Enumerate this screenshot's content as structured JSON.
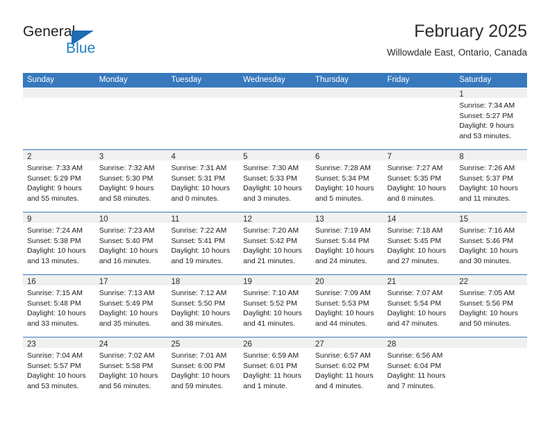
{
  "brand": {
    "name_part1": "General",
    "name_part2": "Blue",
    "triangle_icon": "triangle-icon",
    "accent_color": "#1f7ec4"
  },
  "header": {
    "title": "February 2025",
    "subtitle": "Willowdale East, Ontario, Canada"
  },
  "calendar": {
    "header_bg": "#3879bd",
    "day_strip_bg": "#f0f0f0",
    "weekdays": [
      "Sunday",
      "Monday",
      "Tuesday",
      "Wednesday",
      "Thursday",
      "Friday",
      "Saturday"
    ],
    "weeks": [
      [
        {
          "date": "",
          "lines": []
        },
        {
          "date": "",
          "lines": []
        },
        {
          "date": "",
          "lines": []
        },
        {
          "date": "",
          "lines": []
        },
        {
          "date": "",
          "lines": []
        },
        {
          "date": "",
          "lines": []
        },
        {
          "date": "1",
          "lines": [
            "Sunrise: 7:34 AM",
            "Sunset: 5:27 PM",
            "Daylight: 9 hours",
            "and 53 minutes."
          ]
        }
      ],
      [
        {
          "date": "2",
          "lines": [
            "Sunrise: 7:33 AM",
            "Sunset: 5:29 PM",
            "Daylight: 9 hours",
            "and 55 minutes."
          ]
        },
        {
          "date": "3",
          "lines": [
            "Sunrise: 7:32 AM",
            "Sunset: 5:30 PM",
            "Daylight: 9 hours",
            "and 58 minutes."
          ]
        },
        {
          "date": "4",
          "lines": [
            "Sunrise: 7:31 AM",
            "Sunset: 5:31 PM",
            "Daylight: 10 hours",
            "and 0 minutes."
          ]
        },
        {
          "date": "5",
          "lines": [
            "Sunrise: 7:30 AM",
            "Sunset: 5:33 PM",
            "Daylight: 10 hours",
            "and 3 minutes."
          ]
        },
        {
          "date": "6",
          "lines": [
            "Sunrise: 7:28 AM",
            "Sunset: 5:34 PM",
            "Daylight: 10 hours",
            "and 5 minutes."
          ]
        },
        {
          "date": "7",
          "lines": [
            "Sunrise: 7:27 AM",
            "Sunset: 5:35 PM",
            "Daylight: 10 hours",
            "and 8 minutes."
          ]
        },
        {
          "date": "8",
          "lines": [
            "Sunrise: 7:26 AM",
            "Sunset: 5:37 PM",
            "Daylight: 10 hours",
            "and 11 minutes."
          ]
        }
      ],
      [
        {
          "date": "9",
          "lines": [
            "Sunrise: 7:24 AM",
            "Sunset: 5:38 PM",
            "Daylight: 10 hours",
            "and 13 minutes."
          ]
        },
        {
          "date": "10",
          "lines": [
            "Sunrise: 7:23 AM",
            "Sunset: 5:40 PM",
            "Daylight: 10 hours",
            "and 16 minutes."
          ]
        },
        {
          "date": "11",
          "lines": [
            "Sunrise: 7:22 AM",
            "Sunset: 5:41 PM",
            "Daylight: 10 hours",
            "and 19 minutes."
          ]
        },
        {
          "date": "12",
          "lines": [
            "Sunrise: 7:20 AM",
            "Sunset: 5:42 PM",
            "Daylight: 10 hours",
            "and 21 minutes."
          ]
        },
        {
          "date": "13",
          "lines": [
            "Sunrise: 7:19 AM",
            "Sunset: 5:44 PM",
            "Daylight: 10 hours",
            "and 24 minutes."
          ]
        },
        {
          "date": "14",
          "lines": [
            "Sunrise: 7:18 AM",
            "Sunset: 5:45 PM",
            "Daylight: 10 hours",
            "and 27 minutes."
          ]
        },
        {
          "date": "15",
          "lines": [
            "Sunrise: 7:16 AM",
            "Sunset: 5:46 PM",
            "Daylight: 10 hours",
            "and 30 minutes."
          ]
        }
      ],
      [
        {
          "date": "16",
          "lines": [
            "Sunrise: 7:15 AM",
            "Sunset: 5:48 PM",
            "Daylight: 10 hours",
            "and 33 minutes."
          ]
        },
        {
          "date": "17",
          "lines": [
            "Sunrise: 7:13 AM",
            "Sunset: 5:49 PM",
            "Daylight: 10 hours",
            "and 35 minutes."
          ]
        },
        {
          "date": "18",
          "lines": [
            "Sunrise: 7:12 AM",
            "Sunset: 5:50 PM",
            "Daylight: 10 hours",
            "and 38 minutes."
          ]
        },
        {
          "date": "19",
          "lines": [
            "Sunrise: 7:10 AM",
            "Sunset: 5:52 PM",
            "Daylight: 10 hours",
            "and 41 minutes."
          ]
        },
        {
          "date": "20",
          "lines": [
            "Sunrise: 7:09 AM",
            "Sunset: 5:53 PM",
            "Daylight: 10 hours",
            "and 44 minutes."
          ]
        },
        {
          "date": "21",
          "lines": [
            "Sunrise: 7:07 AM",
            "Sunset: 5:54 PM",
            "Daylight: 10 hours",
            "and 47 minutes."
          ]
        },
        {
          "date": "22",
          "lines": [
            "Sunrise: 7:05 AM",
            "Sunset: 5:56 PM",
            "Daylight: 10 hours",
            "and 50 minutes."
          ]
        }
      ],
      [
        {
          "date": "23",
          "lines": [
            "Sunrise: 7:04 AM",
            "Sunset: 5:57 PM",
            "Daylight: 10 hours",
            "and 53 minutes."
          ]
        },
        {
          "date": "24",
          "lines": [
            "Sunrise: 7:02 AM",
            "Sunset: 5:58 PM",
            "Daylight: 10 hours",
            "and 56 minutes."
          ]
        },
        {
          "date": "25",
          "lines": [
            "Sunrise: 7:01 AM",
            "Sunset: 6:00 PM",
            "Daylight: 10 hours",
            "and 59 minutes."
          ]
        },
        {
          "date": "26",
          "lines": [
            "Sunrise: 6:59 AM",
            "Sunset: 6:01 PM",
            "Daylight: 11 hours",
            "and 1 minute."
          ]
        },
        {
          "date": "27",
          "lines": [
            "Sunrise: 6:57 AM",
            "Sunset: 6:02 PM",
            "Daylight: 11 hours",
            "and 4 minutes."
          ]
        },
        {
          "date": "28",
          "lines": [
            "Sunrise: 6:56 AM",
            "Sunset: 6:04 PM",
            "Daylight: 11 hours",
            "and 7 minutes."
          ]
        },
        {
          "date": "",
          "lines": []
        }
      ]
    ]
  }
}
